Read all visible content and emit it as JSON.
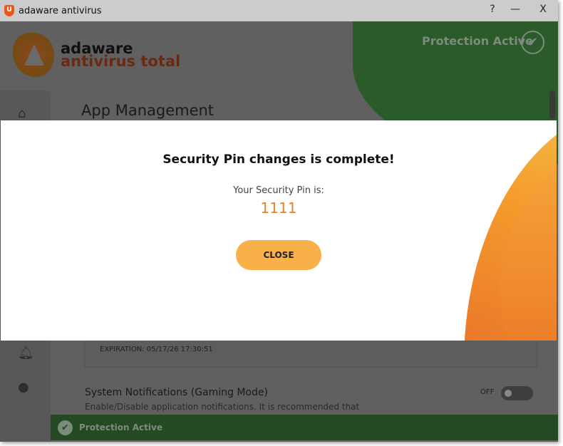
{
  "window": {
    "title": "adaware antivirus",
    "help": "?",
    "minimize": "—",
    "close": "X"
  },
  "header": {
    "brand_line1": "adaware",
    "brand_line2": "antivirus total",
    "protection_status": "Protection Active"
  },
  "main": {
    "page_title": "App Management",
    "expiration": "EXPIRATION: 05/17/26 17:30:51",
    "notifications": {
      "title": "System Notifications (Gaming Mode)",
      "description": "Enable/Disable application notifications. It is recommended that",
      "toggle_label": "OFF",
      "toggle_on": false
    }
  },
  "statusbar": {
    "text": "Protection Active"
  },
  "modal": {
    "title": "Security Pin changes is complete!",
    "subtitle": "Your Security Pin is:",
    "pin": "1111",
    "close_label": "CLOSE"
  },
  "colors": {
    "accent": "#f7b04a",
    "pin": "#e8822a",
    "green": "#2b5a2b"
  }
}
